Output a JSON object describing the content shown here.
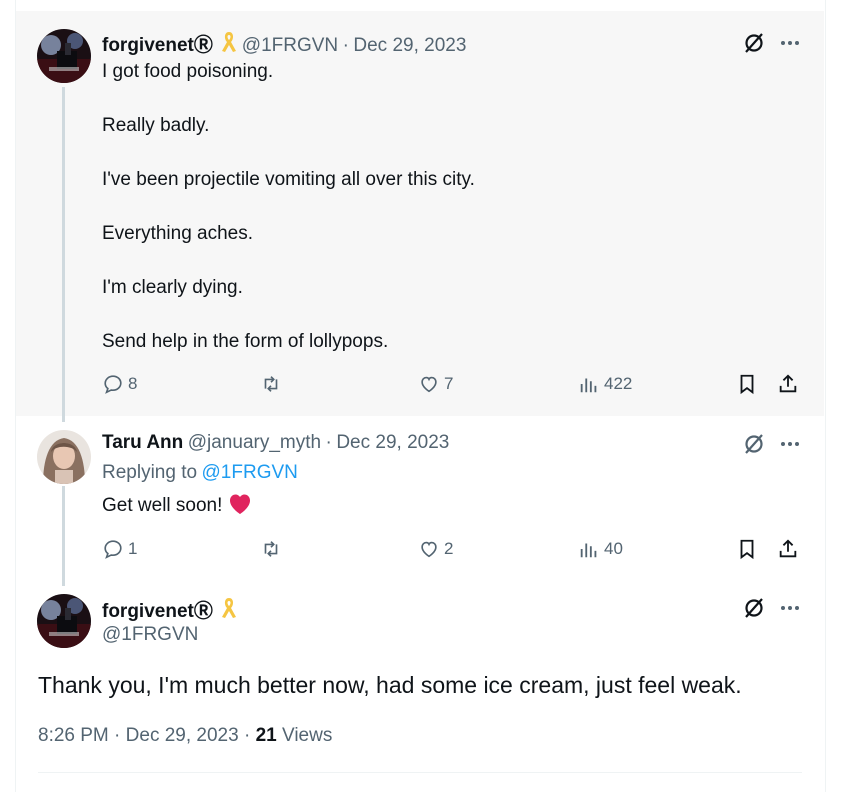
{
  "tweet1": {
    "author_name": "forgivenet",
    "registered_mark": "Ⓡ",
    "handle": "@1FRGVN",
    "date": "Dec 29, 2023",
    "paragraphs": [
      "I got food poisoning.",
      "Really badly.",
      "I've been projectile vomiting all over this city.",
      "Everything aches.",
      "I'm clearly dying.",
      "Send help in the form of lollypops."
    ],
    "replies": "8",
    "likes": "7",
    "views": "422"
  },
  "tweet2": {
    "author_name": "Taru Ann",
    "handle": "@january_myth",
    "date": "Dec 29, 2023",
    "replying_label": "Replying to",
    "replying_handle": "@1FRGVN",
    "text": "Get well soon!",
    "emoji": "❤️",
    "replies": "1",
    "likes": "2",
    "views": "40"
  },
  "tweet3": {
    "author_name": "forgivenet",
    "registered_mark": "Ⓡ",
    "handle": "@1FRGVN",
    "text": "Thank you, I'm much better now, had some ice cream, just feel weak.",
    "time": "8:26 PM",
    "date": "Dec 29, 2023",
    "views_count": "21",
    "views_label": "Views"
  },
  "colors": {
    "text": "#0f1419",
    "secondary": "#536471",
    "link": "#1d9bf0",
    "ribbon": "#f5c542",
    "highlight_bg": "#f7f7f7"
  },
  "icons": [
    "grok-icon",
    "more-icon",
    "reply-icon",
    "retweet-icon",
    "like-icon",
    "views-icon",
    "bookmark-icon",
    "share-icon",
    "awareness-ribbon-icon"
  ]
}
